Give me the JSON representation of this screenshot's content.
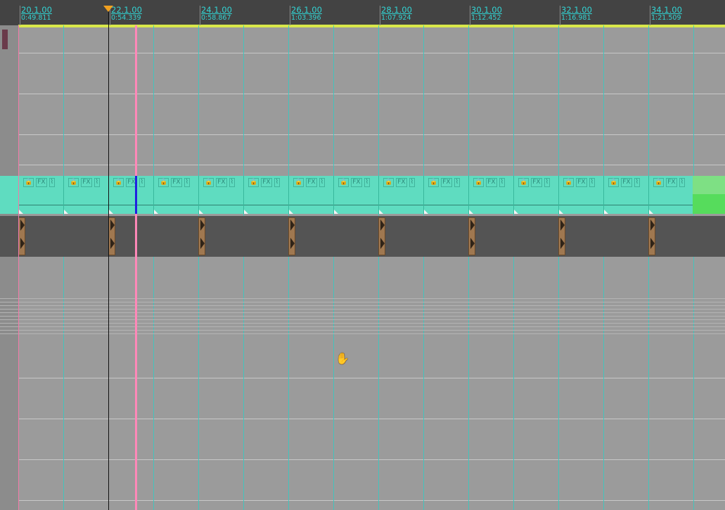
{
  "timeline": {
    "markers": [
      {
        "bar": "20.1.00",
        "time": "0:49.811"
      },
      {
        "bar": "22.1.00",
        "time": "0:54.339"
      },
      {
        "bar": "24.1.00",
        "time": "0:58.867"
      },
      {
        "bar": "26.1.00",
        "time": "1:03.396"
      },
      {
        "bar": "28.1.00",
        "time": "1:07.924"
      },
      {
        "bar": "30.1.00",
        "time": "1:12.452"
      },
      {
        "bar": "32.1.00",
        "time": "1:16.981"
      },
      {
        "bar": "34.1.00",
        "time": "1:21.509"
      }
    ]
  },
  "clips": {
    "icons": [
      "lock-icon",
      "fx",
      "envelope-icon"
    ],
    "fx_label": "FX"
  },
  "colors": {
    "ruler_text": "#32d4d4",
    "clip": "#5fdcc0",
    "clip_green": "#56dc5c",
    "playhead": "#ff88b8",
    "loop_bar": "#d9e84a"
  },
  "cursor": {
    "icon": "hand-icon"
  }
}
